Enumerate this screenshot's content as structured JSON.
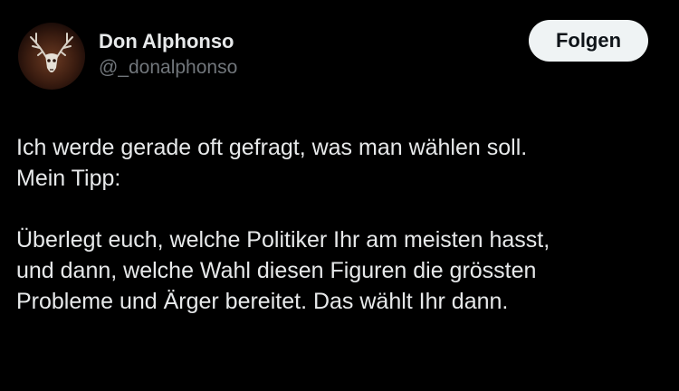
{
  "author": {
    "display_name": "Don Alphonso",
    "handle": "@_donalphonso",
    "avatar_icon": "stag-skull-icon"
  },
  "follow_label": "Folgen",
  "colors": {
    "background": "#000000",
    "text_primary": "#e7e9ea",
    "text_secondary": "#71767b",
    "button_bg": "#eff3f4",
    "button_text": "#0f1419"
  },
  "tweet": {
    "line1": "Ich werde gerade oft gefragt, was man wählen soll.",
    "line2": "Mein Tipp:",
    "line3": "Überlegt euch, welche Politiker Ihr am meisten hasst,",
    "line4": "und dann, welche Wahl diesen Figuren die grössten",
    "line5": "Probleme und Ärger bereitet. Das wählt Ihr dann."
  }
}
